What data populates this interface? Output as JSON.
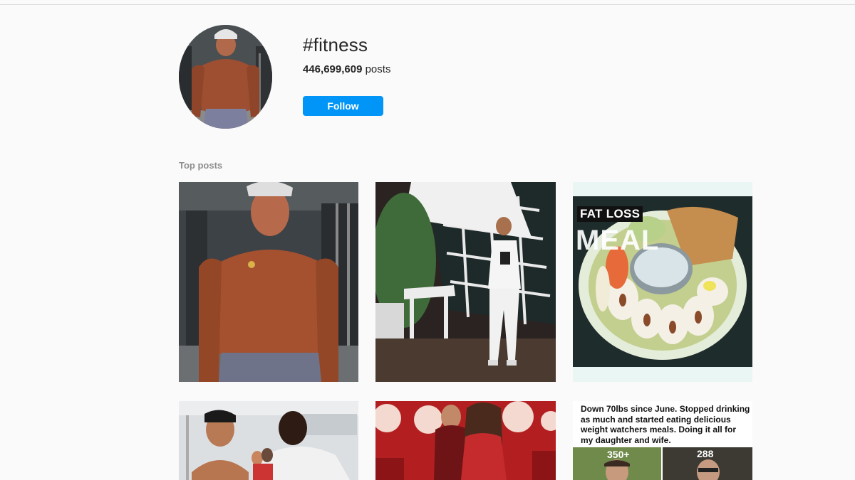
{
  "header": {
    "hashtag": "#fitness",
    "post_count": "446,699,609",
    "post_count_suffix": " posts",
    "follow_label": "Follow"
  },
  "top_posts": {
    "label": "Top posts",
    "post3": {
      "overlay_top": "FAT LOSS",
      "overlay_bottom": "MEAL"
    },
    "post6": {
      "caption": "Down 70lbs since June. Stopped drinking as much and started eating delicious weight watchers meals. Doing it all for my daughter and wife.",
      "left_stat": "350+",
      "right_stat": "288"
    }
  },
  "colors": {
    "follow_button": "#0095f6",
    "background": "#fafafa"
  }
}
